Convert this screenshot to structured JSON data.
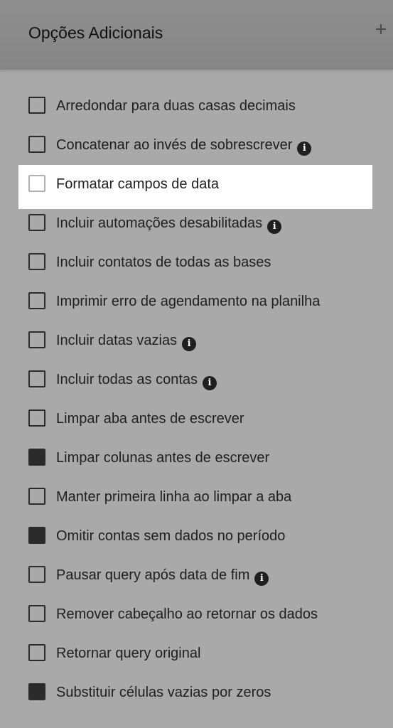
{
  "header": {
    "title": "Opções Adicionais",
    "expand_icon": "plus-icon"
  },
  "options": [
    {
      "label": "Arredondar para duas casas decimais",
      "checked": false,
      "info": false
    },
    {
      "label": "Concatenar ao invés de sobrescrever",
      "checked": false,
      "info": true
    },
    {
      "label": "Formatar campos de data",
      "checked": false,
      "info": false,
      "highlighted": true
    },
    {
      "label": "Incluir automações desabilitadas",
      "checked": false,
      "info": true
    },
    {
      "label": "Incluir contatos de todas as bases",
      "checked": false,
      "info": false
    },
    {
      "label": "Imprimir erro de agendamento na planilha",
      "checked": false,
      "info": false
    },
    {
      "label": "Incluir datas vazias",
      "checked": false,
      "info": true
    },
    {
      "label": "Incluir todas as contas",
      "checked": false,
      "info": true
    },
    {
      "label": "Limpar aba antes de escrever",
      "checked": false,
      "info": false
    },
    {
      "label": "Limpar colunas antes de escrever",
      "checked": true,
      "info": false
    },
    {
      "label": "Manter primeira linha ao limpar a aba",
      "checked": false,
      "info": false
    },
    {
      "label": "Omitir contas sem dados no período",
      "checked": true,
      "info": false
    },
    {
      "label": "Pausar query após data de fim",
      "checked": false,
      "info": true
    },
    {
      "label": "Remover cabeçalho ao retornar os dados",
      "checked": false,
      "info": false
    },
    {
      "label": "Retornar query original",
      "checked": false,
      "info": false
    },
    {
      "label": "Substituir células vazias por zeros",
      "checked": true,
      "info": false
    }
  ],
  "info_icon": {
    "name": "info-icon",
    "glyph": "i"
  },
  "colors": {
    "panel_background": "#a9a9a9",
    "header_background": "#888888",
    "checked_fill": "#2b2b2b",
    "highlight_background": "#ffffff"
  }
}
